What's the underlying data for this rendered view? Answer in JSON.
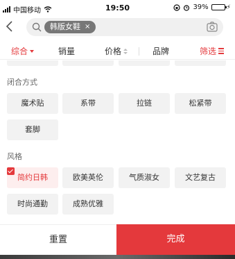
{
  "status_bar": {
    "carrier": "中国移动",
    "time": "19:50",
    "battery_percent": "39%",
    "battery_level": 0.39
  },
  "search": {
    "tag_label": "韩版女鞋",
    "tag_close": "×",
    "icons": [
      "back-icon",
      "search-icon",
      "camera-icon"
    ]
  },
  "sort_bar": {
    "comprehensive": "综合",
    "sales": "销量",
    "price": "价格",
    "brand": "品牌",
    "filter": "筛选"
  },
  "filters": {
    "closure": {
      "title": "闭合方式",
      "options": [
        "魔术贴",
        "系带",
        "拉链",
        "松紧带",
        "套脚"
      ]
    },
    "style": {
      "title": "风格",
      "options": [
        "简约日韩",
        "欧美英伦",
        "气质淑女",
        "文艺复古",
        "时尚通勤",
        "成熟优雅"
      ],
      "selected": "简约日韩"
    }
  },
  "actions": {
    "reset": "重置",
    "done": "完成"
  },
  "colors": {
    "accent": "#e4393c",
    "chip_bg": "#f2f2f2",
    "selected_chip_bg": "#fdeeee"
  }
}
